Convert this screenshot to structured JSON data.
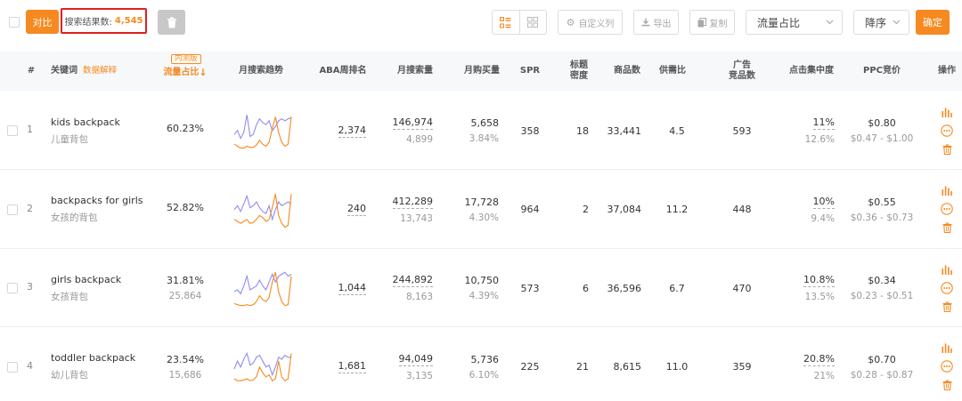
{
  "toolbar": {
    "compare_label": "对比",
    "result_label": "搜索结果数:",
    "result_count": "4,545",
    "custom_columns_label": "自定义列",
    "export_label": "导出",
    "copy_label": "复制",
    "sort_field": "流量占比",
    "sort_order": "降序",
    "confirm_label": "确定"
  },
  "header": {
    "index": "#",
    "keyword": "关键词",
    "data_explain": "数据解释",
    "beta": "内测版",
    "traffic_share": "流量占比",
    "sort_arrow": "↓",
    "trend": "月搜索趋势",
    "aba_rank": "ABA周排名",
    "monthly_search": "月搜索量",
    "monthly_purchase": "月购买量",
    "spr": "SPR",
    "title_density_1": "标题",
    "title_density_2": "密度",
    "product_count": "商品数",
    "supply_demand": "供需比",
    "ad_products_1": "广告",
    "ad_products_2": "竞品数",
    "click_concentration": "点击集中度",
    "ppc_bid": "PPC竞价",
    "actions": "操作"
  },
  "accent_color": "#f6891f",
  "trend_colors": {
    "search": "#8f8cf2",
    "purchase": "#f6891f"
  },
  "rows": [
    {
      "index": "1",
      "keyword_en": "kids backpack",
      "keyword_cn": "儿童背包",
      "traffic_share": "60.23%",
      "traffic_sub": "",
      "aba_rank": "2,374",
      "monthly_search": "146,974",
      "search_sub": "4,899",
      "monthly_purchase": "5,658",
      "purchase_rate": "3.84%",
      "spr": "358",
      "title_density": "18",
      "product_count": "33,441",
      "supply_demand": "4.5",
      "ad_products": "593",
      "click_conc": "11%",
      "click_sub": "12.6%",
      "ppc": "$0.80",
      "ppc_range": "$0.47 - $1.00",
      "trend_search": [
        0.45,
        0.55,
        0.35,
        0.5,
        0.95,
        0.4,
        0.45,
        0.7,
        0.85,
        0.75,
        0.7,
        0.8,
        0.55,
        0.65,
        0.8,
        0.85,
        0.8,
        0.85,
        0.88
      ],
      "trend_purchase": [
        0.2,
        0.15,
        0.1,
        0.1,
        0.15,
        0.12,
        0.12,
        0.18,
        0.3,
        0.2,
        0.15,
        0.25,
        0.6,
        0.9,
        0.5,
        0.25,
        0.15,
        0.2,
        0.9
      ]
    },
    {
      "index": "2",
      "keyword_en": "backpacks for girls",
      "keyword_cn": "女孩的背包",
      "traffic_share": "52.82%",
      "traffic_sub": "",
      "aba_rank": "240",
      "monthly_search": "412,289",
      "search_sub": "13,743",
      "monthly_purchase": "17,728",
      "purchase_rate": "4.30%",
      "spr": "964",
      "title_density": "2",
      "product_count": "37,084",
      "supply_demand": "11.2",
      "ad_products": "448",
      "click_conc": "10%",
      "click_sub": "9.4%",
      "ppc": "$0.55",
      "ppc_range": "$0.36 - $0.73",
      "trend_search": [
        0.55,
        0.65,
        0.5,
        0.7,
        0.9,
        0.6,
        0.65,
        0.75,
        0.6,
        0.5,
        0.45,
        0.65,
        0.3,
        0.55,
        0.75,
        0.65,
        0.7,
        0.75,
        0.7
      ],
      "trend_purchase": [
        0.3,
        0.25,
        0.2,
        0.25,
        0.3,
        0.2,
        0.22,
        0.3,
        0.4,
        0.35,
        0.25,
        0.3,
        0.6,
        0.95,
        0.4,
        0.2,
        0.1,
        0.15,
        0.95
      ]
    },
    {
      "index": "3",
      "keyword_en": "girls backpack",
      "keyword_cn": "女孩背包",
      "traffic_share": "31.81%",
      "traffic_sub": "25,864",
      "aba_rank": "1,044",
      "monthly_search": "244,892",
      "search_sub": "8,163",
      "monthly_purchase": "10,750",
      "purchase_rate": "4.39%",
      "spr": "573",
      "title_density": "6",
      "product_count": "36,596",
      "supply_demand": "6.7",
      "ad_products": "470",
      "click_conc": "10.8%",
      "click_sub": "13.5%",
      "ppc": "$0.34",
      "ppc_range": "$0.23 - $0.51",
      "trend_search": [
        0.45,
        0.5,
        0.4,
        0.6,
        0.85,
        0.5,
        0.55,
        0.6,
        0.75,
        0.6,
        0.5,
        0.7,
        0.9,
        0.7,
        0.85,
        0.9,
        0.95,
        0.85,
        0.9
      ],
      "trend_purchase": [
        0.15,
        0.12,
        0.1,
        0.1,
        0.12,
        0.1,
        0.12,
        0.2,
        0.35,
        0.25,
        0.2,
        0.3,
        0.7,
        0.95,
        0.45,
        0.2,
        0.1,
        0.12,
        0.85
      ]
    },
    {
      "index": "4",
      "keyword_en": "toddler backpack",
      "keyword_cn": "幼儿背包",
      "traffic_share": "23.54%",
      "traffic_sub": "15,686",
      "aba_rank": "1,681",
      "monthly_search": "94,049",
      "search_sub": "3,135",
      "monthly_purchase": "5,736",
      "purchase_rate": "6.10%",
      "spr": "225",
      "title_density": "21",
      "product_count": "8,615",
      "supply_demand": "11.0",
      "ad_products": "359",
      "click_conc": "20.8%",
      "click_sub": "21%",
      "ppc": "$0.70",
      "ppc_range": "$0.28 - $0.87",
      "trend_search": [
        0.5,
        0.7,
        0.55,
        0.75,
        0.9,
        0.6,
        0.65,
        0.8,
        0.85,
        0.7,
        0.55,
        0.6,
        0.35,
        0.55,
        0.8,
        0.75,
        0.85,
        0.8,
        0.8
      ],
      "trend_purchase": [
        0.25,
        0.2,
        0.2,
        0.22,
        0.25,
        0.2,
        0.22,
        0.3,
        0.55,
        0.4,
        0.3,
        0.35,
        0.2,
        0.25,
        0.7,
        0.3,
        0.2,
        0.25,
        0.9
      ]
    }
  ]
}
